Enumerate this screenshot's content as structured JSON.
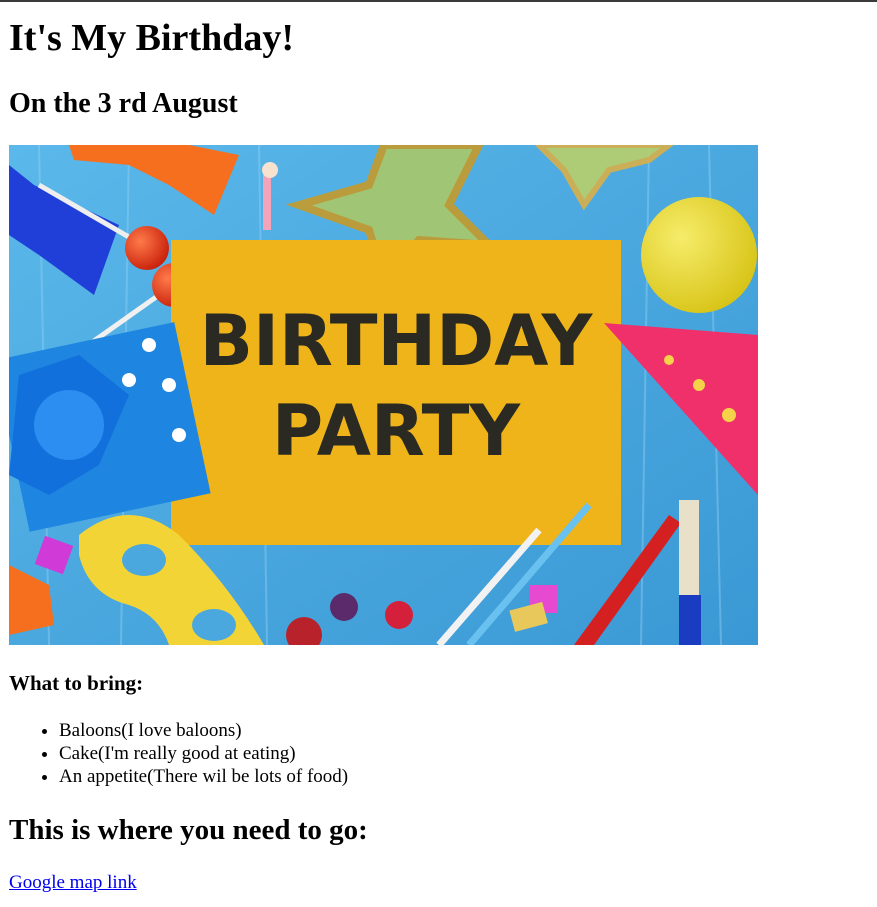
{
  "heading": "It's My Birthday!",
  "date_heading": "On the 3 rd August",
  "image": {
    "line1": "BIRTHDAY",
    "line2": "PARTY",
    "colors": {
      "background": "#4aa8de",
      "card": "#efb41a",
      "ink": "#2a2a22"
    }
  },
  "bring_heading": "What to bring:",
  "bring_items": [
    "Baloons(I love baloons)",
    "Cake(I'm really good at eating)",
    "An appetite(There wil be lots of food)"
  ],
  "where_heading": "This is where you need to go:",
  "map_link": "Google map link"
}
